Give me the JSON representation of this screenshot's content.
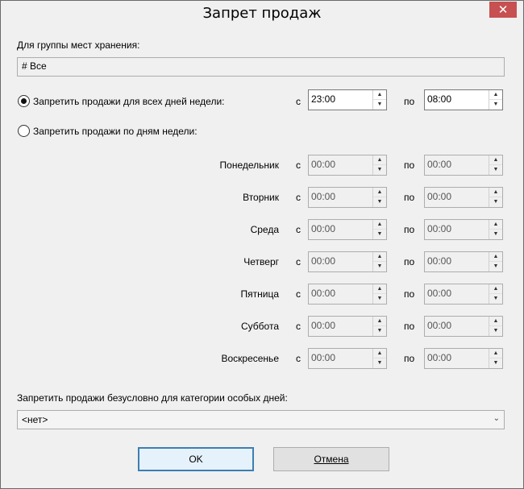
{
  "window": {
    "title": "Запрет продаж",
    "close_glyph": "✕"
  },
  "group": {
    "label": "Для группы мест хранения:",
    "value": "# Все"
  },
  "all_days": {
    "label": "Запретить продажи для всех дней недели:",
    "checked": true,
    "from_label": "с",
    "from": "23:00",
    "to_label": "по",
    "to": "08:00"
  },
  "by_days": {
    "label": "Запретить продажи по дням недели:",
    "checked": false
  },
  "days": [
    {
      "name": "Понедельник",
      "from_label": "с",
      "from": "00:00",
      "to_label": "по",
      "to": "00:00"
    },
    {
      "name": "Вторник",
      "from_label": "с",
      "from": "00:00",
      "to_label": "по",
      "to": "00:00"
    },
    {
      "name": "Среда",
      "from_label": "с",
      "from": "00:00",
      "to_label": "по",
      "to": "00:00"
    },
    {
      "name": "Четверг",
      "from_label": "с",
      "from": "00:00",
      "to_label": "по",
      "to": "00:00"
    },
    {
      "name": "Пятница",
      "from_label": "с",
      "from": "00:00",
      "to_label": "по",
      "to": "00:00"
    },
    {
      "name": "Суббота",
      "from_label": "с",
      "from": "00:00",
      "to_label": "по",
      "to": "00:00"
    },
    {
      "name": "Воскресенье",
      "from_label": "с",
      "from": "00:00",
      "to_label": "по",
      "to": "00:00"
    }
  ],
  "special": {
    "label": "Запретить продажи безусловно для категории особых дней:",
    "value": "<нет>"
  },
  "buttons": {
    "ok": "OK",
    "cancel": "Отмена"
  },
  "icons": {
    "spin_up": "▲",
    "spin_down": "▼",
    "combo_arrow": "⌄"
  }
}
